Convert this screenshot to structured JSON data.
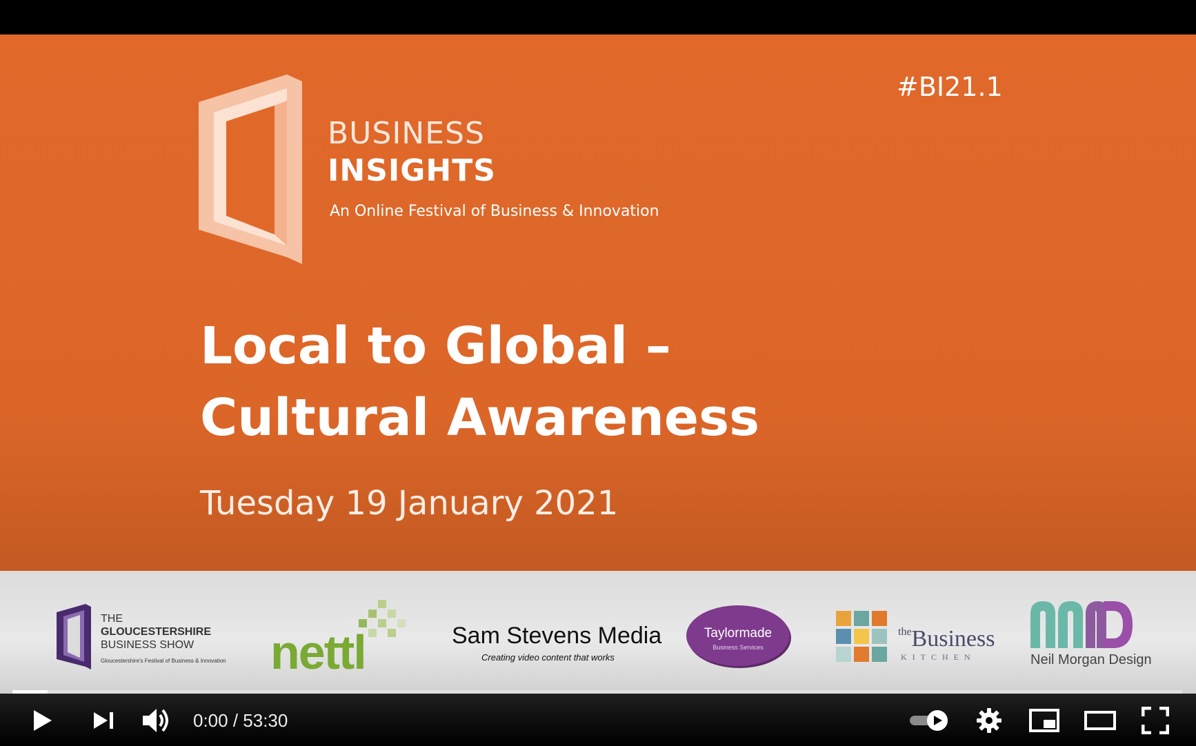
{
  "slide": {
    "hashtag": "#BI21.1",
    "brand_line1": "BUSINESS",
    "brand_line2": "INSIGHTS",
    "tagline": "An Online Festival of Business & Innovation",
    "title_line1": "Local to Global –",
    "title_line2": "Cultural Awareness",
    "date": "Tuesday 19 January 2021"
  },
  "sponsors": {
    "gloucestershire": {
      "line1": "THE",
      "line2": "GLOUCESTERSHIRE",
      "line3": "BUSINESS SHOW",
      "sub": "Gloucestershire's Festival of Business & Innovation"
    },
    "nettl": "nettl",
    "sam_stevens": {
      "name": "Sam Stevens Media",
      "tagline": "Creating video content that works"
    },
    "taylormade": {
      "name": "Taylormade",
      "sub": "Business Services"
    },
    "business_kitchen": {
      "name": "Business",
      "prefix": "the",
      "sub": "KITCHEN"
    },
    "neil_morgan": {
      "name": "Neil Morgan Design"
    }
  },
  "player": {
    "time_display": "0:00 / 53:30",
    "progress": 0.03,
    "autoplay": "on",
    "icons": [
      "play-icon",
      "next-icon",
      "volume-icon",
      "autoplay-toggle",
      "settings-icon",
      "miniplayer-icon",
      "theater-icon",
      "fullscreen-icon"
    ]
  },
  "colors": {
    "slide_orange": "#dc6628",
    "nettl_green": "#7aaa33",
    "taylormade_purple": "#7e3a8c"
  }
}
